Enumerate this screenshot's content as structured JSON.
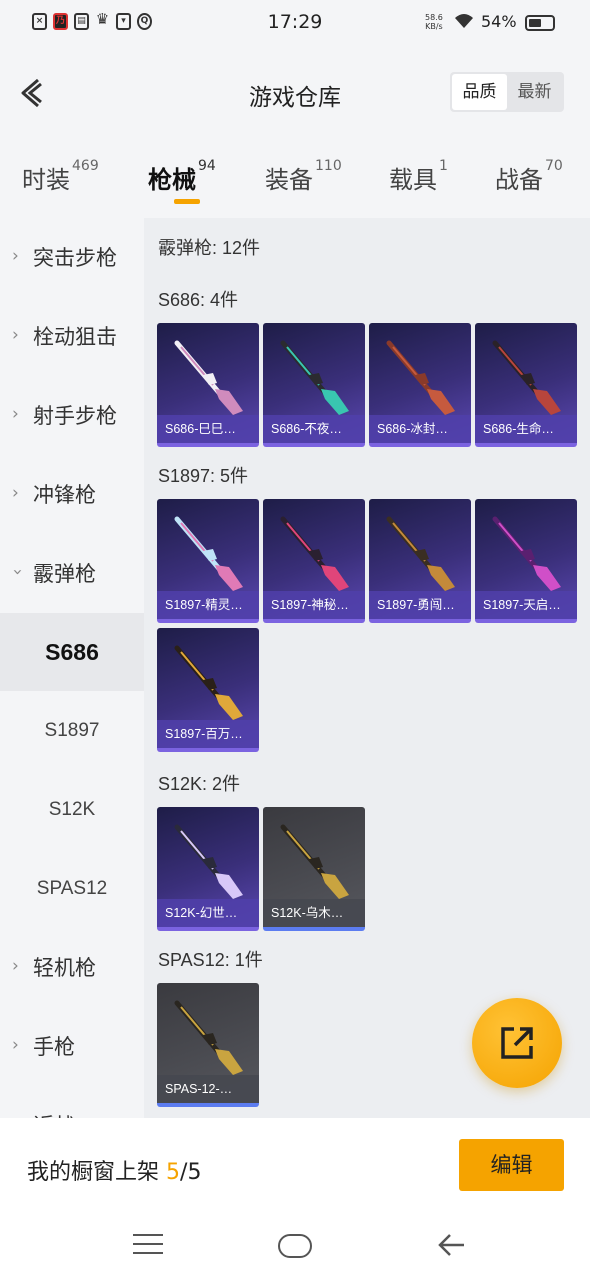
{
  "status_bar": {
    "time": "17:29",
    "net_speed_value": "58.6",
    "net_speed_unit": "KB/s",
    "battery": "54%",
    "battery_level": 0.54
  },
  "header": {
    "title": "游戏仓库",
    "sort_options": [
      "品质",
      "最新"
    ],
    "active_sort": "品质"
  },
  "tabs": [
    {
      "label": "时装",
      "count": "469"
    },
    {
      "label": "枪械",
      "count": "94"
    },
    {
      "label": "装备",
      "count": "110"
    },
    {
      "label": "载具",
      "count": "1"
    },
    {
      "label": "战备",
      "count": "70"
    }
  ],
  "sidebar": {
    "categories": [
      "突击步枪",
      "栓动狙击",
      "射手步枪",
      "冲锋枪",
      "霰弹枪"
    ],
    "sub_items": [
      "S686",
      "S1897",
      "S12K",
      "SPAS12"
    ],
    "active_sub": "S686",
    "more_categories": [
      "轻机枪",
      "手枪",
      "近战"
    ]
  },
  "content": {
    "category_header": "霰弹枪: 12件",
    "groups": [
      {
        "title": "S686: 4件",
        "items": [
          {
            "name": "S686-巳巳…",
            "theme": "purple",
            "colors": [
              "#f2f0f5",
              "#d08bbd"
            ]
          },
          {
            "name": "S686-不夜…",
            "theme": "purple",
            "colors": [
              "#2b2b30",
              "#39c6b0"
            ]
          },
          {
            "name": "S686-冰封…",
            "theme": "purple",
            "colors": [
              "#8a3a2a",
              "#c65a3e"
            ]
          },
          {
            "name": "S686-生命…",
            "theme": "purple",
            "colors": [
              "#2a2228",
              "#b8453c"
            ]
          }
        ]
      },
      {
        "title": "S1897: 5件",
        "items": [
          {
            "name": "S1897-精灵…",
            "theme": "purple",
            "colors": [
              "#bfe4f7",
              "#e07ab6"
            ]
          },
          {
            "name": "S1897-神秘…",
            "theme": "purple",
            "colors": [
              "#2a2030",
              "#e0457a"
            ]
          },
          {
            "name": "S1897-勇闯…",
            "theme": "purple",
            "colors": [
              "#3a2e22",
              "#c48a3a"
            ]
          },
          {
            "name": "S1897-天启…",
            "theme": "purple",
            "colors": [
              "#5a2070",
              "#d04fc8"
            ]
          },
          {
            "name": "S1897-百万…",
            "theme": "purple",
            "colors": [
              "#2a2018",
              "#e0a83a"
            ]
          }
        ]
      },
      {
        "title": "S12K: 2件",
        "items": [
          {
            "name": "S12K-幻世…",
            "theme": "purple",
            "colors": [
              "#2a2a3a",
              "#d8c8f8"
            ]
          },
          {
            "name": "S12K-乌木…",
            "theme": "gray",
            "colors": [
              "#2a2620",
              "#c9a440"
            ]
          }
        ]
      },
      {
        "title": "SPAS12: 1件",
        "items": [
          {
            "name": "SPAS-12-…",
            "theme": "gray",
            "colors": [
              "#2a2620",
              "#c9a440"
            ]
          }
        ]
      }
    ]
  },
  "bottom": {
    "showcase_label": "我的橱窗上架",
    "showcase_current": "5",
    "showcase_sep": "/",
    "showcase_total": "5",
    "edit_label": "编辑"
  }
}
